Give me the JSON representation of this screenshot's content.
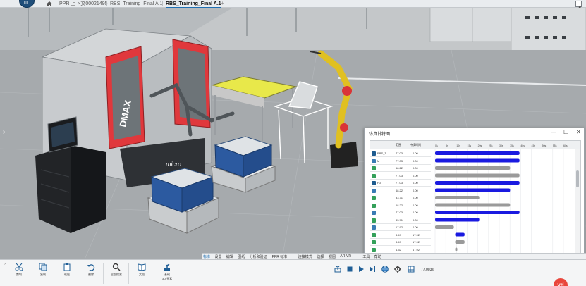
{
  "tabs": {
    "items": [
      {
        "label": "PPR 上下文00021495"
      },
      {
        "label": "RBS_Training_Final A.1"
      },
      {
        "label": "RBS_Training_Final A.1"
      }
    ],
    "add": "+"
  },
  "logo": {
    "text": "UI"
  },
  "scene": {
    "nav_left": "›",
    "machine_brand": "DMAX",
    "machine_label": "micro"
  },
  "gantt": {
    "title": "仿真甘特图",
    "controls": {
      "minimize": "—",
      "maximize": "☐",
      "close": "✕"
    },
    "columns": {
      "start": "范围",
      "duration": "持续时间"
    },
    "ticks": [
      "0s",
      "5s",
      "10s",
      "15s",
      "20s",
      "25s",
      "30s",
      "35s",
      "40s",
      "45s",
      "50s",
      "55s",
      "60s"
    ],
    "rows": [
      {
        "name": "RBS_T",
        "start": "77.03",
        "dur": "0.00",
        "icon": "#1d5b8f"
      },
      {
        "name": "M",
        "start": "77.03",
        "dur": "0.00",
        "icon": "#3a7bb4"
      },
      {
        "name": "",
        "start": "68.22",
        "dur": "0.00",
        "icon": "#34a05a"
      },
      {
        "name": "",
        "start": "77.03",
        "dur": "0.00",
        "icon": "#34a05a"
      },
      {
        "name": "Fu",
        "start": "77.03",
        "dur": "0.00",
        "icon": "#1d5b8f"
      },
      {
        "name": "",
        "start": "68.22",
        "dur": "0.00",
        "icon": "#3a7bb4"
      },
      {
        "name": "",
        "start": "33.71",
        "dur": "0.00",
        "icon": "#34a05a"
      },
      {
        "name": "",
        "start": "68.22",
        "dur": "0.00",
        "icon": "#34a05a"
      },
      {
        "name": "",
        "start": "77.03",
        "dur": "0.00",
        "icon": "#3a7bb4"
      },
      {
        "name": "",
        "start": "33.71",
        "dur": "0.00",
        "icon": "#34a05a"
      },
      {
        "name": "",
        "start": "17.92",
        "dur": "0.00",
        "icon": "#3a7bb4"
      },
      {
        "name": "",
        "start": "8.49",
        "dur": "17.92",
        "icon": "#34a05a"
      },
      {
        "name": "",
        "start": "8.49",
        "dur": "17.92",
        "icon": "#34a05a"
      },
      {
        "name": "",
        "start": "1.52",
        "dur": "17.92",
        "icon": "#34a05a"
      }
    ],
    "bar_blue": "#1a1ae0",
    "bar_gray": "#9a9a9a"
  },
  "ribbon": {
    "tabs": [
      "标准",
      "设置",
      "编辑",
      "图纸",
      "分析和验证",
      "PPR 标准",
      "连接模式",
      "选择",
      "视图",
      "AR-VR",
      "工具",
      "帮助"
    ]
  },
  "toolbar": {
    "expand": "›",
    "tools": [
      {
        "label": "剪切",
        "icon": "scissors-icon"
      },
      {
        "label": "复制",
        "icon": "copy-icon"
      },
      {
        "label": "粘贴",
        "icon": "paste-icon"
      },
      {
        "label": "删除",
        "icon": "undo-icon"
      },
      {
        "label": "全部搜索",
        "icon": "magnifier-icon"
      },
      {
        "label": "文档",
        "icon": "book-icon"
      },
      {
        "label": "基础\n3D 元素",
        "icon": "robot-3d-icon"
      }
    ],
    "time": "77.003s",
    "badge": "yd"
  }
}
